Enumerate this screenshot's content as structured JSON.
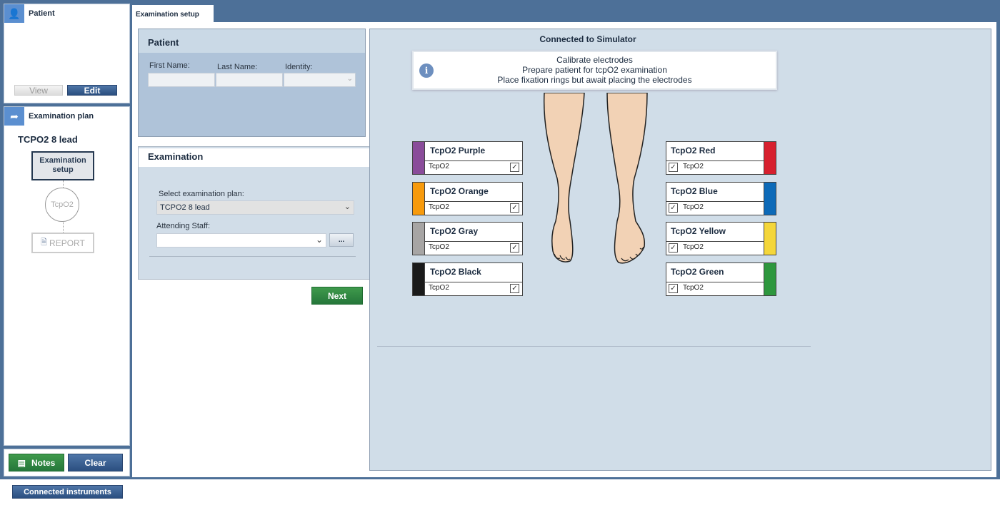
{
  "patient_panel": {
    "title": "Patient",
    "icon": "user-icon",
    "view_label": "View",
    "edit_label": "Edit"
  },
  "plan_panel": {
    "title": "Examination plan",
    "icon": "share-arrow-icon",
    "plan_name": "TCPO2 8 lead",
    "steps": [
      {
        "label": "Examination setup"
      },
      {
        "label": "TcpO2"
      },
      {
        "label": "REPORT",
        "icon": "report-icon"
      }
    ]
  },
  "notes_label": "Notes",
  "clear_label": "Clear",
  "connected_instruments_label": "Connected instruments",
  "tab": {
    "label": "Examination setup"
  },
  "patient_form": {
    "title": "Patient",
    "first_name_label": "First Name:",
    "last_name_label": "Last Name:",
    "identity_label": "Identity:",
    "first_name": "",
    "last_name": "",
    "identity": ""
  },
  "exam_form": {
    "title": "Examination",
    "plan_label": "Select examination plan:",
    "plan_value": "TCPO2 8 lead",
    "staff_label": "Attending Staff:",
    "staff_value": "",
    "browse_label": "...",
    "next_label": "Next"
  },
  "status": {
    "title": "Connected to Simulator",
    "icon": "info-icon",
    "lines": [
      "Calibrate electrodes",
      "Prepare patient for tcpO2 examination",
      "Place fixation rings but await placing the electrodes"
    ]
  },
  "electrodes_left": [
    {
      "name": "TcpO2 Purple",
      "type": "TcpO2",
      "checked": true,
      "color": "#8a4c9a"
    },
    {
      "name": "TcpO2 Orange",
      "type": "TcpO2",
      "checked": true,
      "color": "#f79a0c"
    },
    {
      "name": "TcpO2 Gray",
      "type": "TcpO2",
      "checked": true,
      "color": "#a7a5a4"
    },
    {
      "name": "TcpO2 Black",
      "type": "TcpO2",
      "checked": true,
      "color": "#1a1a1a"
    }
  ],
  "electrodes_right": [
    {
      "name": "TcpO2 Red",
      "type": "TcpO2",
      "checked": true,
      "color": "#d7202e"
    },
    {
      "name": "TcpO2 Blue",
      "type": "TcpO2",
      "checked": true,
      "color": "#0d6ab8"
    },
    {
      "name": "TcpO2 Yellow",
      "type": "TcpO2",
      "checked": true,
      "color": "#f4d63a"
    },
    {
      "name": "TcpO2 Green",
      "type": "TcpO2",
      "checked": true,
      "color": "#2e973e"
    }
  ]
}
